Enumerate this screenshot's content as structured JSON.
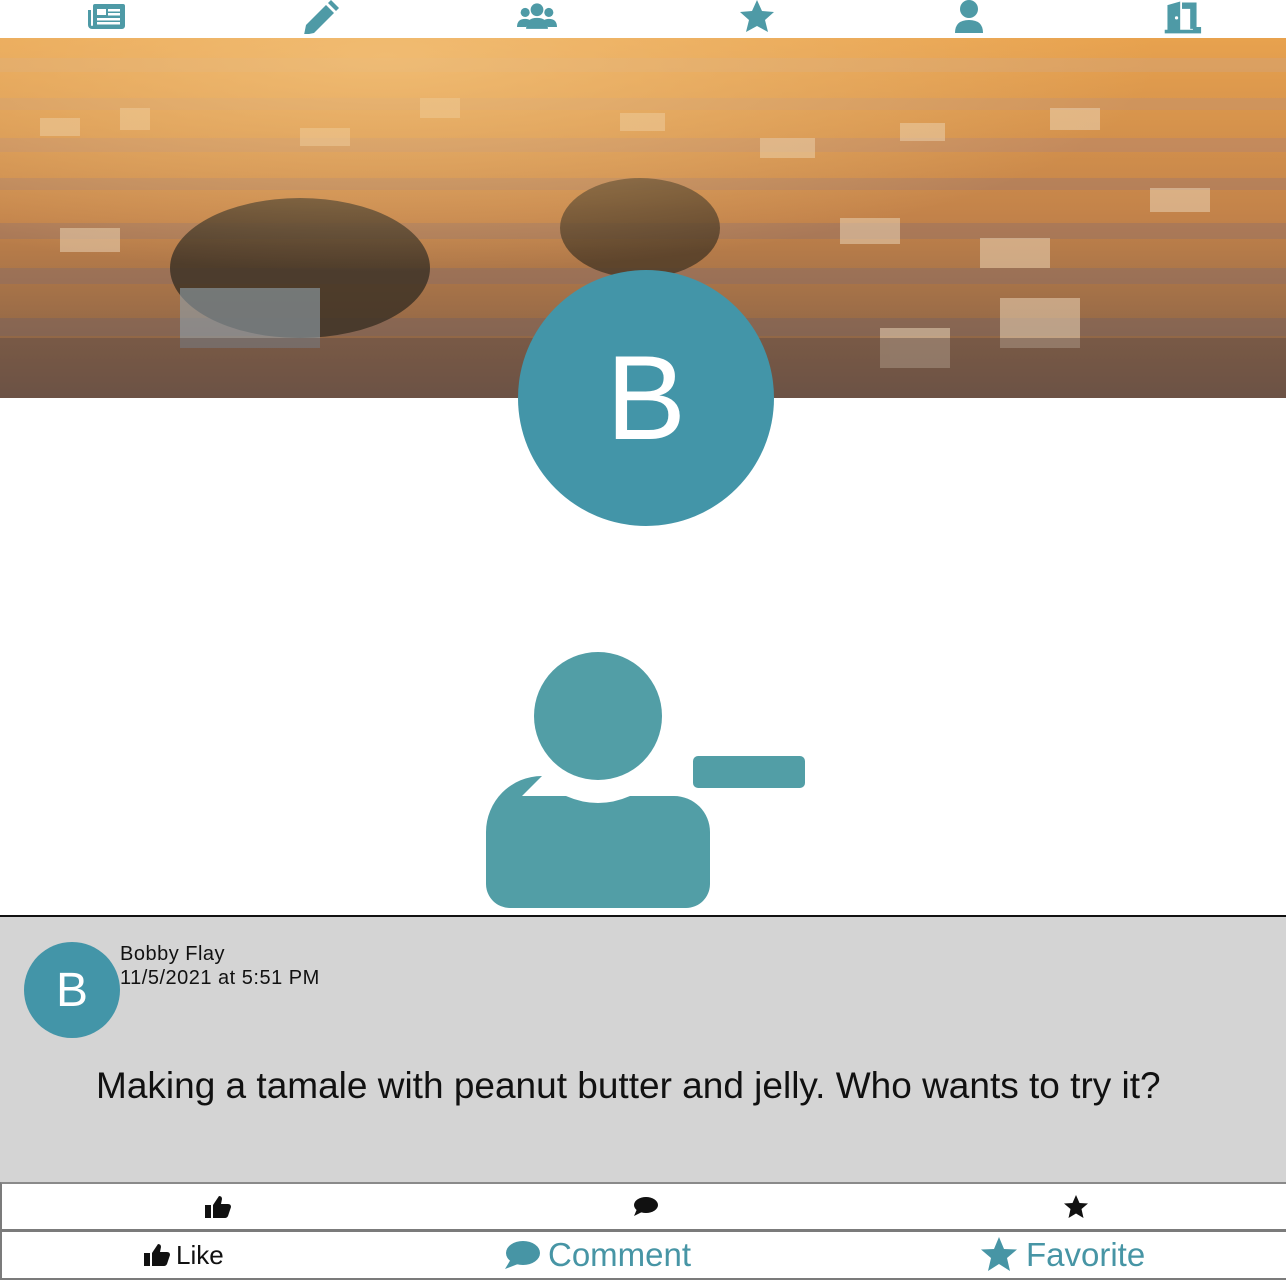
{
  "nav": {
    "items": [
      {
        "icon": "newspaper-icon"
      },
      {
        "icon": "pencil-icon"
      },
      {
        "icon": "users-icon"
      },
      {
        "icon": "star-icon"
      },
      {
        "icon": "user-icon"
      },
      {
        "icon": "door-exit-icon"
      }
    ],
    "color": "#4e9aa6"
  },
  "profile": {
    "initial": "B",
    "avatar_color": "#4395a8",
    "action_icon": "user-minus-icon"
  },
  "post": {
    "author": "Bobby Flay",
    "timestamp": "11/5/2021 at 5:51 PM",
    "initial": "B",
    "body": "Making a tamale with peanut butter and jelly. Who wants to try it?"
  },
  "reactions": {
    "icons": [
      "thumbs-up-icon",
      "comment-icon",
      "star-icon"
    ]
  },
  "actions": {
    "like": "Like",
    "comment": "Comment",
    "favorite": "Favorite",
    "accent": "#4795a5"
  }
}
